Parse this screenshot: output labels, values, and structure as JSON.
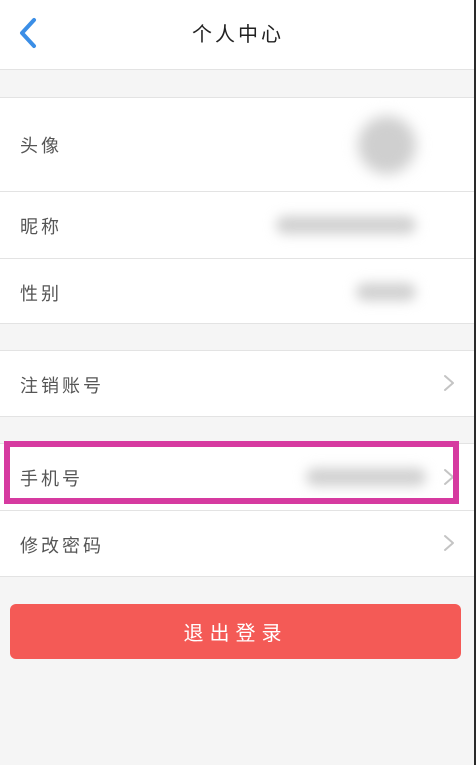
{
  "header": {
    "title": "个人中心"
  },
  "profile": {
    "avatar_label": "头像",
    "nickname_label": "昵称",
    "gender_label": "性别"
  },
  "account": {
    "cancel_label": "注销账号"
  },
  "security": {
    "phone_label": "手机号",
    "password_label": "修改密码"
  },
  "actions": {
    "logout_label": "退出登录"
  },
  "colors": {
    "accent": "#3b8ee6",
    "logout_button": "#f45a56",
    "highlight": "#d63aa0"
  }
}
